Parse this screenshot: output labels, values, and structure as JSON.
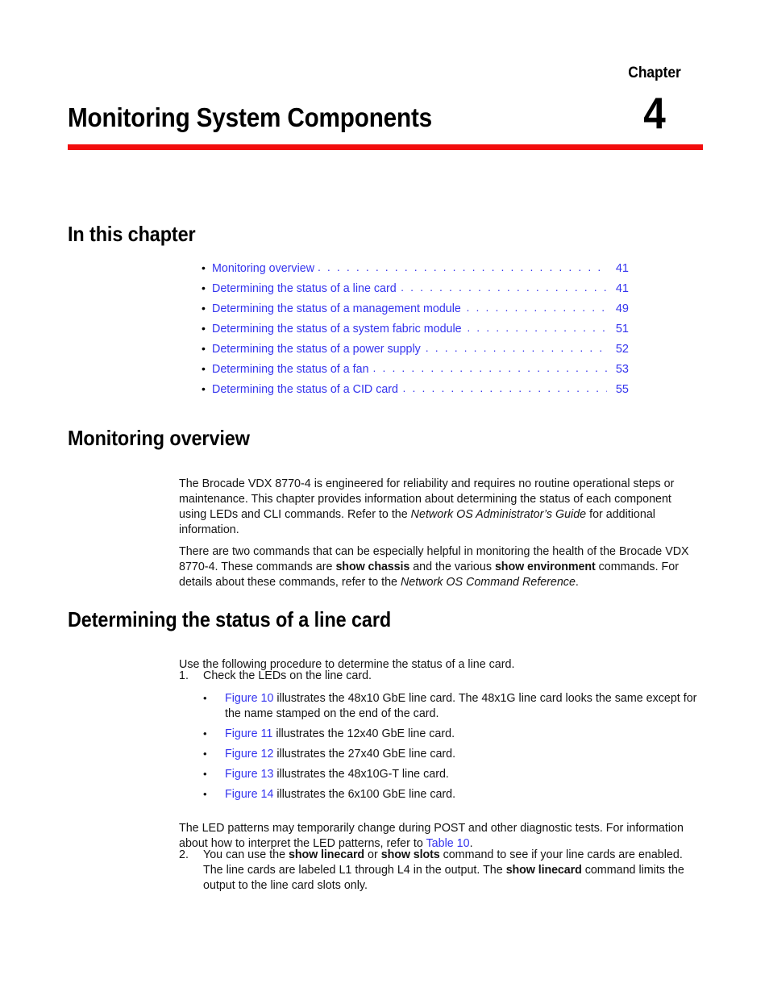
{
  "chapter": {
    "label": "Chapter",
    "number": "4",
    "title": "Monitoring System Components",
    "rule_color": "#f20d0d"
  },
  "link_color": "#3434ee",
  "headings": {
    "in_this_chapter": "In this chapter",
    "monitoring_overview": "Monitoring overview",
    "line_card": "Determining the status of a line card"
  },
  "toc": {
    "bullet": "•",
    "leader": ". . . . . . . . . . . . . . . . . . . . . . . . . . . . . . . . . . . . . . . . . . . . . . . . . . . . . . . . . . . . . . . . . . .",
    "entries": [
      {
        "label": "Monitoring overview",
        "page": "41"
      },
      {
        "label": "Determining the status of a line card",
        "page": "41"
      },
      {
        "label": "Determining the status of a management module",
        "page": "49"
      },
      {
        "label": "Determining the status of a system fabric module",
        "page": "51"
      },
      {
        "label": "Determining the status of a power supply",
        "page": "52"
      },
      {
        "label": "Determining the status of a fan",
        "page": "53"
      },
      {
        "label": "Determining the status of a CID card",
        "page": "55"
      }
    ]
  },
  "monitoring_overview": {
    "paragraph_1": {
      "text_1": "The Brocade VDX 8770-4 is engineered for reliability and requires no routine operational steps or maintenance. This chapter provides information about determining the status of each component using LEDs and CLI commands. Refer to the ",
      "italic_1": "Network OS Administrator’s Guide",
      "text_2": " for additional information."
    },
    "paragraph_2": {
      "text_1": "There are two commands that can be especially helpful in monitoring the health of the Brocade VDX 8770-4. These commands are ",
      "bold_1": "show chassis",
      "text_2": " and the various ",
      "bold_2": "show environment",
      "text_3": " commands. For details about these commands, refer to the ",
      "italic_1": "Network OS Command Reference",
      "text_4": "."
    }
  },
  "line_card_section": {
    "intro": "Use the following procedure to determine the status of a line card.",
    "step_1": {
      "number": "1.",
      "text": "Check the LEDs on the line card."
    },
    "bullet_marker": "•",
    "figure_bullets": [
      {
        "link": "Figure 10",
        "text": " illustrates the 48x10 GbE line card. The 48x1G line card looks the same except for the name stamped on the end of the card."
      },
      {
        "link": "Figure 11",
        "text": " illustrates the 12x40 GbE line card."
      },
      {
        "link": "Figure 12",
        "text": " illustrates the 27x40 GbE line card."
      },
      {
        "link": "Figure 13",
        "text": " illustrates the 48x10G-T line card."
      },
      {
        "link": "Figure 14",
        "text": " illustrates the 6x100 GbE line card."
      }
    ],
    "led_patterns": {
      "text_1": "The LED patterns may temporarily change during POST and other diagnostic tests. For information about how to interpret the LED patterns, refer to ",
      "link_1": "Table 10",
      "text_2": "."
    },
    "step_2": {
      "number": "2.",
      "text_1": "You can use the ",
      "bold_1": "show linecard",
      "text_2": " or ",
      "bold_2": "show slots",
      "text_3": " command to see if your line cards are enabled. The line cards are labeled L1 through L4 in the output. The ",
      "bold_3": "show linecard",
      "text_4": " command limits the output to the line card slots only."
    }
  }
}
